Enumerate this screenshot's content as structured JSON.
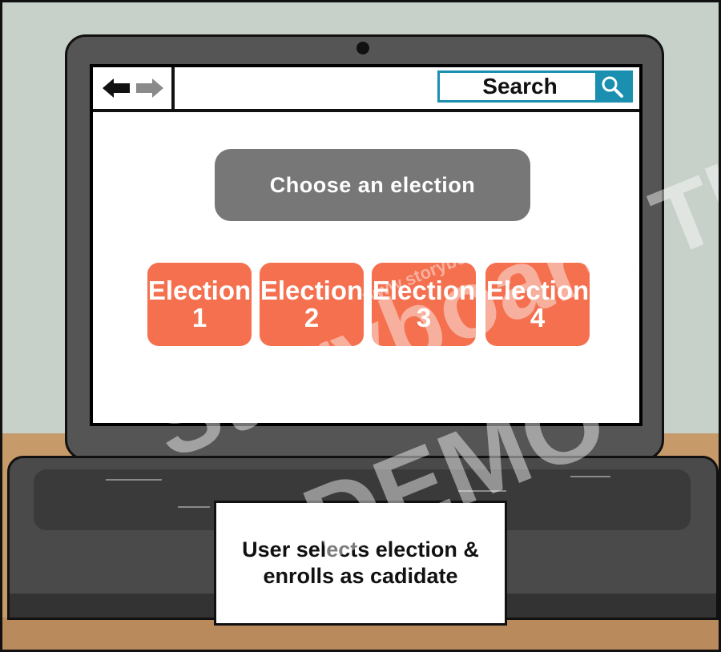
{
  "browser": {
    "search_label": "Search",
    "icons": {
      "back": "back-arrow-icon",
      "forward": "forward-arrow-icon",
      "search": "magnifier-icon"
    }
  },
  "main": {
    "title": "Choose an election",
    "elections": [
      {
        "word": "Election",
        "number": "1"
      },
      {
        "word": "Election",
        "number": "2"
      },
      {
        "word": "Election",
        "number": "3"
      },
      {
        "word": "Election",
        "number": "4"
      }
    ]
  },
  "caption": {
    "text": "User selects election & enrolls as cadidate"
  },
  "watermark": {
    "brand": "Storyboard That",
    "url": "www.storyboardthat.com",
    "demo": "DEMO"
  },
  "colors": {
    "election_button": "#f4704f",
    "title_pill": "#777777",
    "search_accent": "#1a8fb0",
    "wall": "#c7d0c9",
    "desk": "#c79a6a"
  }
}
